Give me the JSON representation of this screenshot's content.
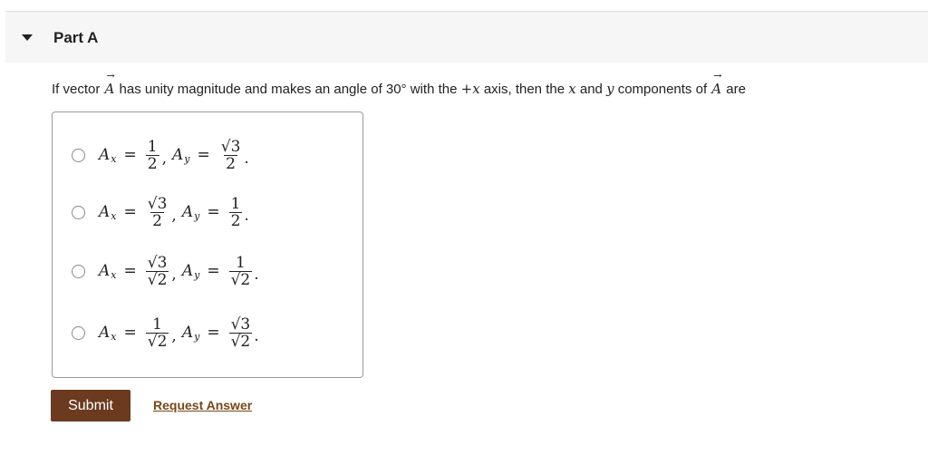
{
  "part": {
    "title": "Part A"
  },
  "question": {
    "t1": "If vector ",
    "vec": "A",
    "t2": " has unity magnitude and makes an angle of 30° with the ",
    "plusx": "+x",
    "t3": " axis, then the ",
    "x": "x",
    "t4": " and ",
    "y": "y",
    "t5": " components of ",
    "t6": " are"
  },
  "choices": [
    {
      "ax": {
        "num": "1",
        "den": "2"
      },
      "ay": {
        "num": "√3",
        "den": "2"
      }
    },
    {
      "ax": {
        "num": "√3",
        "den": "2"
      },
      "ay": {
        "num": "1",
        "den": "2"
      }
    },
    {
      "ax": {
        "num": "√3",
        "den": "√2"
      },
      "ay": {
        "num": "1",
        "den": "√2"
      }
    },
    {
      "ax": {
        "num": "1",
        "den": "√2"
      },
      "ay": {
        "num": "√3",
        "den": "√2"
      }
    }
  ],
  "math": {
    "A": "A",
    "sx": "x",
    "sy": "y",
    "eq": "=",
    "comma": ",",
    "period": "."
  },
  "actions": {
    "submit": "Submit",
    "request": "Request Answer"
  },
  "colors": {
    "submit_bg": "#6b3a1f",
    "link": "#7a4617",
    "header_bg": "#f6f6f6"
  }
}
